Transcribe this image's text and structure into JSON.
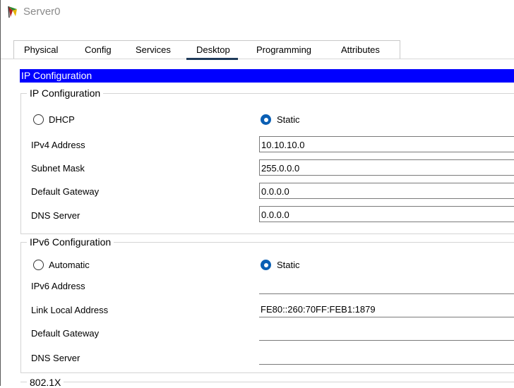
{
  "window": {
    "title": "Server0"
  },
  "tabs": [
    {
      "label": "Physical"
    },
    {
      "label": "Config"
    },
    {
      "label": "Services"
    },
    {
      "label": "Desktop"
    },
    {
      "label": "Programming"
    },
    {
      "label": "Attributes"
    }
  ],
  "active_tab": "Desktop",
  "panel": {
    "header": "IP Configuration"
  },
  "ipv4": {
    "group_label": "IP Configuration",
    "mode_dhcp": "DHCP",
    "mode_static": "Static",
    "selected_mode": "Static",
    "address_label": "IPv4 Address",
    "address_value": "10.10.10.0",
    "mask_label": "Subnet Mask",
    "mask_value": "255.0.0.0",
    "gateway_label": "Default Gateway",
    "gateway_value": "0.0.0.0",
    "dns_label": "DNS Server",
    "dns_value": "0.0.0.0"
  },
  "ipv6": {
    "group_label": "IPv6 Configuration",
    "mode_auto": "Automatic",
    "mode_static": "Static",
    "selected_mode": "Static",
    "address_label": "IPv6 Address",
    "address_value": "",
    "link_local_label": "Link Local Address",
    "link_local_value": "FE80::260:70FF:FEB1:1879",
    "gateway_label": "Default Gateway",
    "gateway_value": "",
    "dns_label": "DNS Server",
    "dns_value": ""
  },
  "dot1x": {
    "group_label": "802.1X"
  },
  "colors": {
    "header_bar": "#0000ff",
    "radio_selected": "#0a5fb4",
    "tab_underline": "#1f3a5a"
  },
  "icons": {
    "app": "server-router-icon"
  }
}
